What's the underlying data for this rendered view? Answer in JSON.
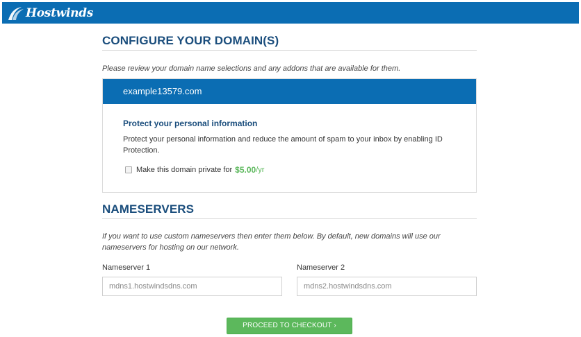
{
  "header": {
    "logo_text": "Hostwinds",
    "logo_icon": "hostwinds-swoosh-icon",
    "bg_color": "#0b6db3"
  },
  "configure": {
    "title": "CONFIGURE YOUR DOMAIN(S)",
    "intro": "Please review your domain name selections and any addons that are available for them."
  },
  "domain": {
    "name": "example13579.com",
    "protect_title": "Protect your personal information",
    "protect_desc": "Protect your personal information and reduce the amount of spam to your inbox by enabling ID Protection.",
    "private_label": "Make this domain private for",
    "private_checked": false,
    "price": "$5.00",
    "price_period": "/yr",
    "price_color": "#5cb85c"
  },
  "nameservers": {
    "title": "NAMESERVERS",
    "intro": "If you want to use custom nameservers then enter them below. By default, new domains will use our nameservers for hosting on our network.",
    "ns1_label": "Nameserver 1",
    "ns1_placeholder": "mdns1.hostwindsdns.com",
    "ns1_value": "",
    "ns2_label": "Nameserver 2",
    "ns2_placeholder": "mdns2.hostwindsdns.com",
    "ns2_value": ""
  },
  "actions": {
    "checkout_label": "PROCEED TO CHECKOUT ›",
    "checkout_color": "#5cb85c"
  }
}
